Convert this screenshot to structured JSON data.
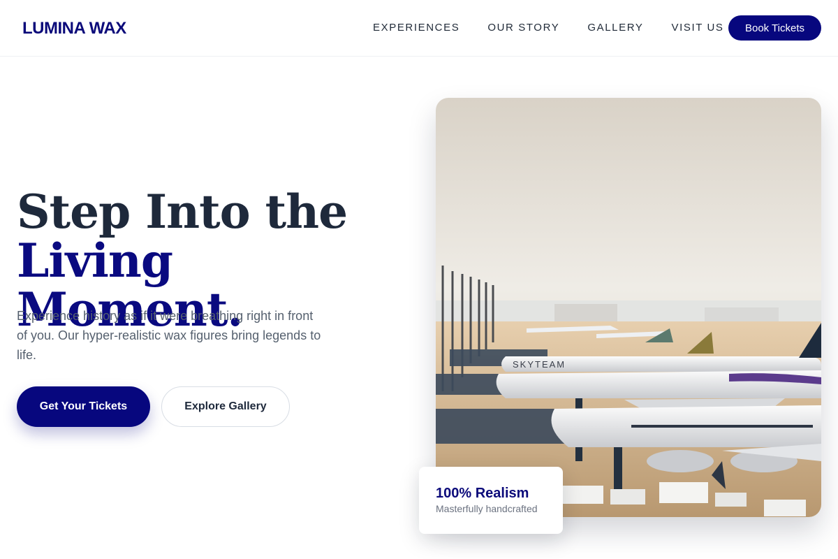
{
  "brand": {
    "logo": "LUMINA WAX",
    "accent": "#07077e"
  },
  "nav": {
    "items": [
      {
        "label": "EXPERIENCES"
      },
      {
        "label": "OUR STORY"
      },
      {
        "label": "GALLERY"
      },
      {
        "label": "VISIT US"
      }
    ],
    "cta_label": "Book Tickets"
  },
  "hero": {
    "title_line1": "Step Into the",
    "title_line2": "Living Moment.",
    "subtitle": "Experience history as if it were breathing right in front of you. Our hyper-realistic wax figures bring legends to life.",
    "primary_cta": "Get Your Tickets",
    "secondary_cta": "Explore Gallery"
  },
  "image": {
    "icon": "airport-photo",
    "visible_text": "SKYTEAM"
  },
  "stat_card": {
    "title": "100% Realism",
    "subtitle": "Masterfully handcrafted"
  }
}
